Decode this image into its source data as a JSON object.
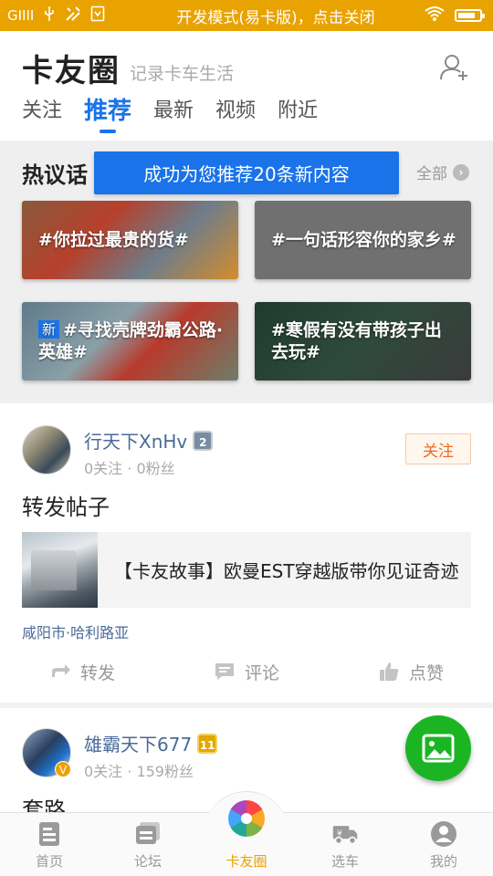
{
  "status_bar": {
    "notice": "开发模式(易卡版)，点击关闭",
    "signal_text": "GIIII",
    "bg_color": "#e9a300"
  },
  "header": {
    "title": "卡友圈",
    "subtitle": "记录卡车生活",
    "tabs": [
      {
        "label": "关注",
        "active": false
      },
      {
        "label": "推荐",
        "active": true
      },
      {
        "label": "最新",
        "active": false
      },
      {
        "label": "视频",
        "active": false
      },
      {
        "label": "附近",
        "active": false
      }
    ],
    "accent_color": "#1a73e8"
  },
  "hot_topics": {
    "title": "热议话题",
    "title_visible": "热议话",
    "all_label": "全部",
    "toast": "成功为您推荐20条新内容",
    "topics": [
      {
        "text": "#你拉过最贵的货#",
        "new": false
      },
      {
        "text": "#一句话形容你的家乡#",
        "new": false
      },
      {
        "text": "#寻找壳牌劲霸公路·英雄#",
        "new": true,
        "badge": "新"
      },
      {
        "text": "#寒假有没有带孩子出去玩#",
        "new": false
      }
    ]
  },
  "posts": [
    {
      "username": "行天下XnHv",
      "level": "2",
      "stats": "0关注 · 0粉丝",
      "follow_label": "关注",
      "text": "转发帖子",
      "shared_title": "【卡友故事】欧曼EST穿越版带你见证奇迹",
      "location": "咸阳市·哈利路亚",
      "actions": {
        "repost": "转发",
        "comment": "评论",
        "like": "点赞"
      }
    },
    {
      "username": "雄霸天下677",
      "level": "11",
      "verified_mark": "V",
      "stats": "0关注 · 159粉丝",
      "text": "套路"
    }
  ],
  "bottom_nav": {
    "items": [
      {
        "label": "首页",
        "icon": "home-doc-icon",
        "active": false
      },
      {
        "label": "论坛",
        "icon": "forum-icon",
        "active": false
      },
      {
        "label": "卡友圈",
        "icon": "pinwheel-icon",
        "active": true
      },
      {
        "label": "选车",
        "icon": "truck-icon",
        "active": false
      },
      {
        "label": "我的",
        "icon": "profile-icon",
        "active": false
      }
    ],
    "active_color": "#e9a300"
  }
}
